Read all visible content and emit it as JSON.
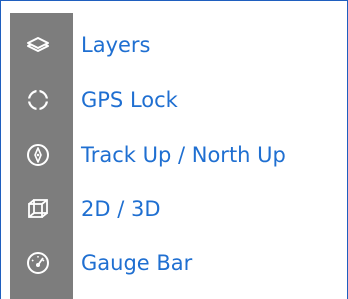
{
  "theme": {
    "label_color": "#1f6fd1",
    "icon_color": "#ffffff",
    "rail_color": "#7d7d7d",
    "border_color": "#1f5fbf"
  },
  "menu": {
    "items": [
      {
        "label": "Layers",
        "icon": "layers-icon"
      },
      {
        "label": "GPS Lock",
        "icon": "gps-lock-icon"
      },
      {
        "label": "Track Up / North Up",
        "icon": "compass-icon"
      },
      {
        "label": "2D / 3D",
        "icon": "cube-icon"
      },
      {
        "label": "Gauge Bar",
        "icon": "gauge-icon"
      }
    ]
  }
}
